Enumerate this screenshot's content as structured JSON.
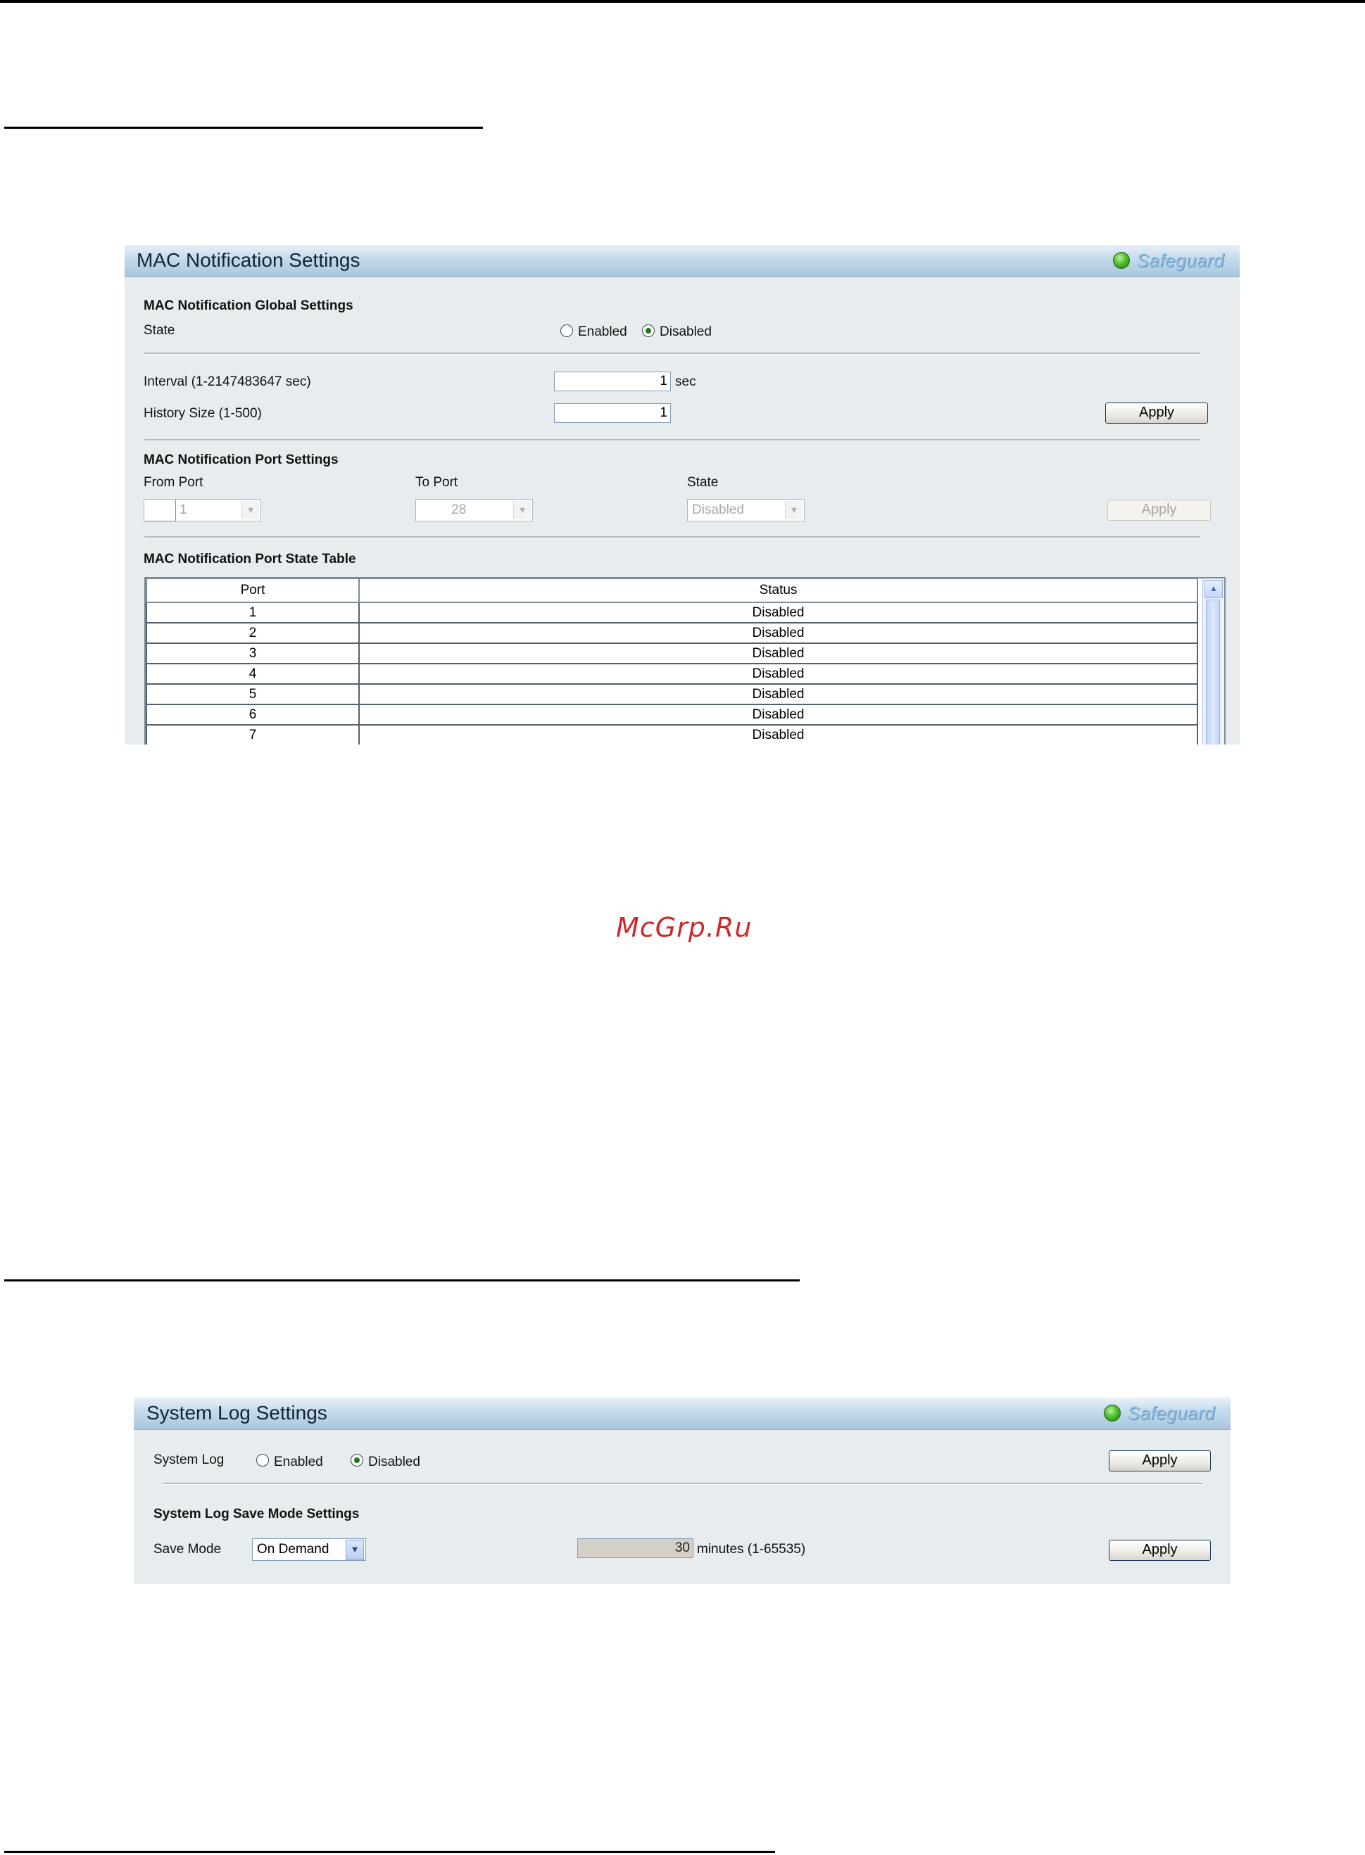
{
  "mac_panel": {
    "title": "MAC Notification Settings",
    "safeguard": "Safeguard",
    "global_heading": "MAC Notification Global Settings",
    "state_label": "State",
    "state_options": [
      "Enabled",
      "Disabled"
    ],
    "state_selected": "Disabled",
    "interval_label": "Interval (1-2147483647 sec)",
    "interval_value": "1",
    "interval_unit": "sec",
    "history_label": "History Size (1-500)",
    "history_value": "1",
    "apply_label": "Apply",
    "port_heading": "MAC Notification Port Settings",
    "from_port_label": "From Port",
    "from_port_value": "1",
    "to_port_label": "To Port",
    "to_port_value": "28",
    "port_state_label": "State",
    "port_state_value": "Disabled",
    "port_apply_label": "Apply",
    "table_heading": "MAC Notification Port State Table",
    "table": {
      "columns": [
        "Port",
        "Status"
      ],
      "rows": [
        [
          "1",
          "Disabled"
        ],
        [
          "2",
          "Disabled"
        ],
        [
          "3",
          "Disabled"
        ],
        [
          "4",
          "Disabled"
        ],
        [
          "5",
          "Disabled"
        ],
        [
          "6",
          "Disabled"
        ],
        [
          "7",
          "Disabled"
        ]
      ]
    }
  },
  "watermark": "McGrp.Ru",
  "syslog_panel": {
    "title": "System Log Settings",
    "safeguard": "Safeguard",
    "system_log_label": "System Log",
    "options": [
      "Enabled",
      "Disabled"
    ],
    "selected": "Disabled",
    "apply_label": "Apply",
    "save_mode_heading": "System Log Save Mode Settings",
    "save_mode_label": "Save Mode",
    "save_mode_value": "On Demand",
    "minutes_value": "30",
    "minutes_label": "minutes (1-65535)",
    "save_apply_label": "Apply"
  },
  "colors": {
    "safeguard_green": "#4fbf2a",
    "watermark": "#cc2a2a",
    "header_blue": "#a9c6dd"
  }
}
